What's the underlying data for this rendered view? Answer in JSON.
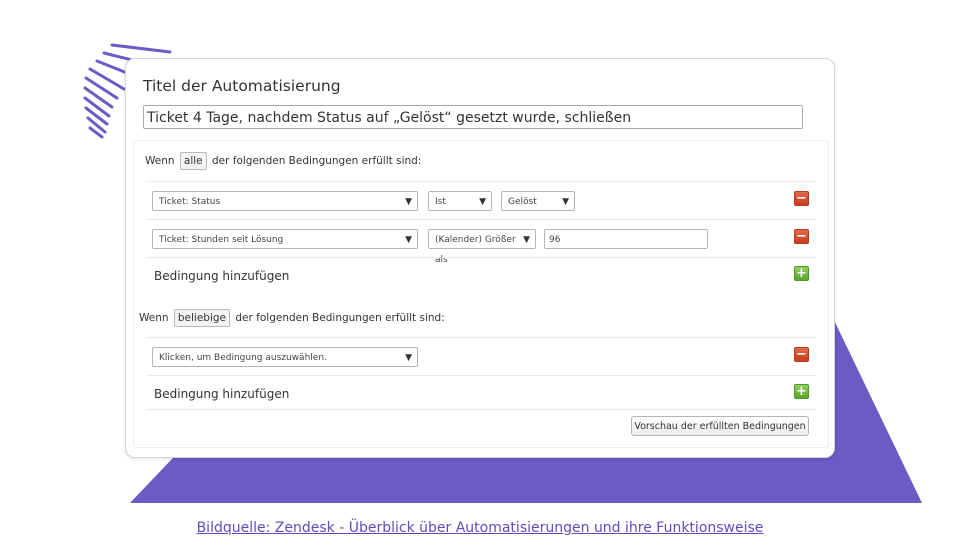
{
  "colors": {
    "accent_purple": "#6b5bc5",
    "caption": "#5b4fbf",
    "remove": "#d9533a",
    "add": "#6cbd3c"
  },
  "automation": {
    "title_label": "Titel der Automatisierung",
    "title_value": "Ticket 4 Tage, nachdem Status auf „Gelöst“ gesetzt wurde, schließen"
  },
  "all_group": {
    "prefix": "Wenn",
    "mode": "alle",
    "suffix": "der folgenden Bedingungen erfüllt sind:",
    "conditions": [
      {
        "field": "Ticket: Status",
        "operator": "Ist",
        "value": "Gelöst"
      },
      {
        "field": "Ticket: Stunden seit Lösung",
        "operator": "(Kalender) Größer als",
        "value": "96"
      }
    ],
    "add_label": "Bedingung hinzufügen"
  },
  "any_group": {
    "prefix": "Wenn",
    "mode": "beliebige",
    "suffix": "der folgenden Bedingungen erfüllt sind:",
    "conditions": [
      {
        "field": "Klicken, um Bedingung auszuwählen."
      }
    ],
    "add_label": "Bedingung hinzufügen"
  },
  "preview_button": "Vorschau der erfüllten Bedingungen",
  "icons": {
    "remove": "minus-icon",
    "add": "plus-icon",
    "dropdown": "chevron-down-icon"
  },
  "caption": "Bildquelle: Zendesk - Überblick über Automatisierungen und ihre Funktionsweise"
}
